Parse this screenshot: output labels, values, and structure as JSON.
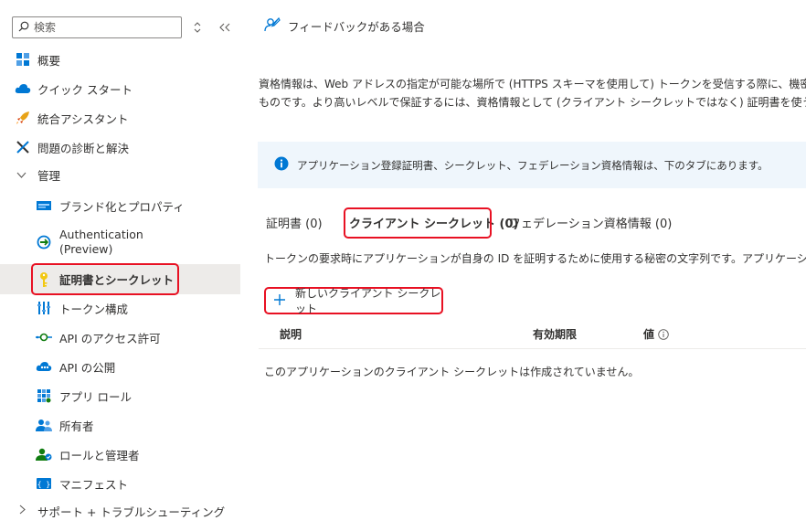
{
  "search": {
    "placeholder": "検索"
  },
  "sidebar": {
    "items": [
      {
        "label": "概要"
      },
      {
        "label": "クイック スタート"
      },
      {
        "label": "統合アシスタント"
      },
      {
        "label": "問題の診断と解決"
      },
      {
        "label": "管理"
      },
      {
        "label": "ブランド化とプロパティ"
      },
      {
        "label": "Authentication\n(Preview)"
      },
      {
        "label": "証明書とシークレット"
      },
      {
        "label": "トークン構成"
      },
      {
        "label": "API のアクセス許可"
      },
      {
        "label": "API の公開"
      },
      {
        "label": "アプリ ロール"
      },
      {
        "label": "所有者"
      },
      {
        "label": "ロールと管理者"
      },
      {
        "label": "マニフェスト"
      },
      {
        "label": "サポート + トラブルシューティング"
      }
    ]
  },
  "main": {
    "feedback_label": "フィードバックがある場合",
    "description_line1": "資格情報は、Web アドレスの指定が可能な場所で (HTTPS スキーマを使用して) トークンを受信する際に、機密性の",
    "description_line2": "ものです。より高いレベルで保証するには、資格情報として (クライアント シークレットではなく) 証明書を使うことをお勧め",
    "info_text": "アプリケーション登録証明書、シークレット、フェデレーション資格情報は、下のタブにあります。",
    "tabs": [
      {
        "label": "証明書 (0)"
      },
      {
        "label": "クライアント シークレット (0)"
      },
      {
        "label": "フェデレーション資格情報 (0)"
      }
    ],
    "tab_description": "トークンの要求時にアプリケーションが自身の ID を証明するために使用する秘密の文字列です。アプリケーション パスワ",
    "new_secret_label": "新しいクライアント シークレット",
    "table": {
      "columns": [
        "説明",
        "有効期限",
        "値"
      ],
      "empty_message": "このアプリケーションのクライアント シークレットは作成されていません。"
    }
  },
  "colors": {
    "highlight": "#e81123",
    "selected_bg": "#edebe9",
    "info_bg": "#eff6fc",
    "accent": "#0078d4"
  }
}
